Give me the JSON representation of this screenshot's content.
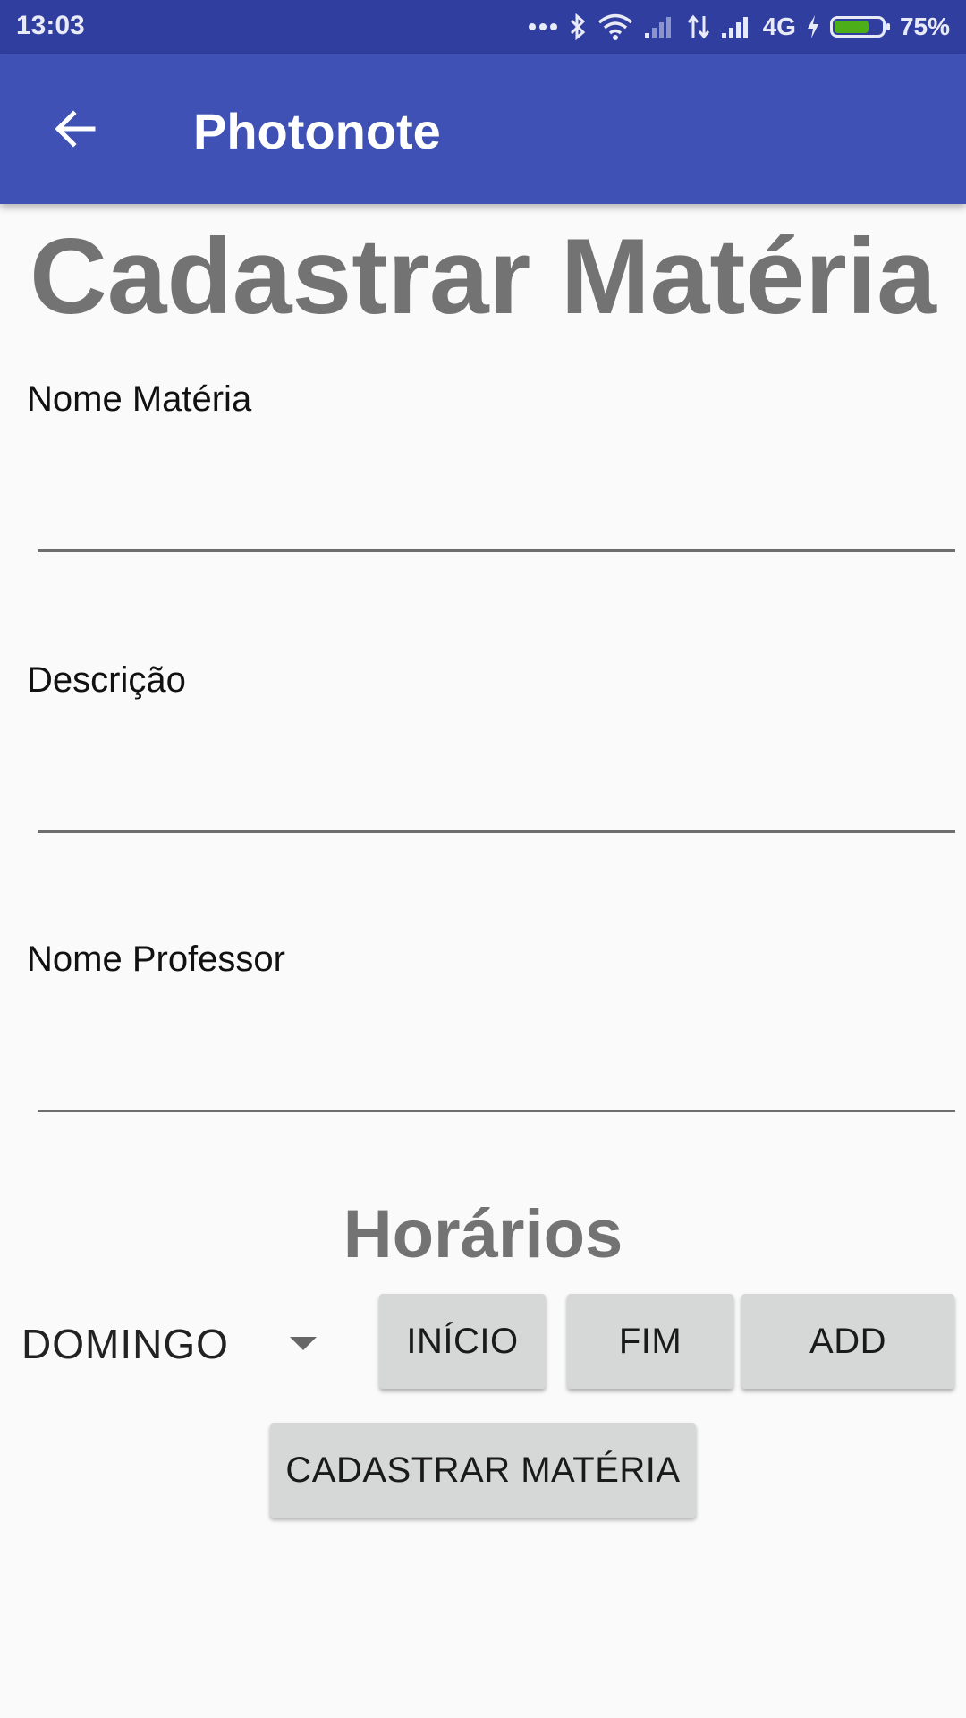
{
  "status_bar": {
    "time": "13:03",
    "network": "4G",
    "battery_text": "75%",
    "battery_level": 0.75,
    "icons": [
      "more-dots-icon",
      "bluetooth-icon",
      "wifi-icon",
      "signal-icon",
      "data-transfer-icon",
      "signal-icon",
      "charging-icon",
      "battery-icon"
    ]
  },
  "app_bar": {
    "title": "Photonote",
    "back_icon": "arrow-back-icon"
  },
  "page": {
    "title": "Cadastrar Matéria"
  },
  "form": {
    "fields": [
      {
        "label": "Nome Matéria",
        "value": ""
      },
      {
        "label": "Descrição",
        "value": ""
      },
      {
        "label": "Nome Professor",
        "value": ""
      }
    ]
  },
  "schedule": {
    "title": "Horários",
    "day_selected": "DOMINGO",
    "start_label": "INÍCIO",
    "end_label": "FIM",
    "add_label": "ADD"
  },
  "submit_label": "CADASTRAR MATÉRIA",
  "colors": {
    "status_bar": "#303f9f",
    "app_bar": "#3f51b5",
    "background": "#fafafa",
    "title_gray": "#737373",
    "button_bg": "#d6d7d7",
    "battery_fill": "#4caf1a"
  }
}
